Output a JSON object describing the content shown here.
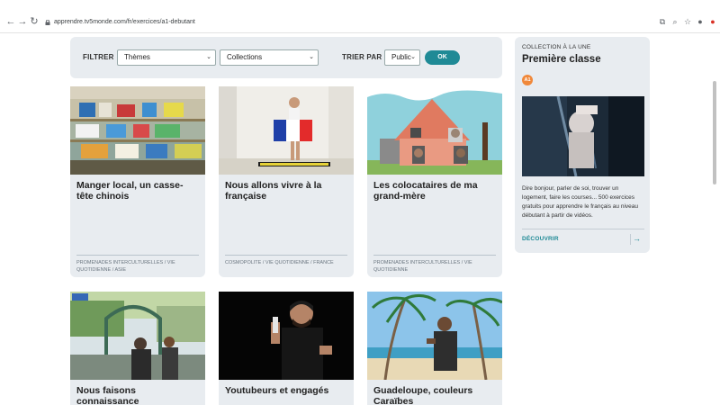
{
  "browser": {
    "url": "apprendre.tv5monde.com/fr/exercices/a1-debutant",
    "icons": [
      "back-icon",
      "forward-icon",
      "reload-icon",
      "lock-icon",
      "translate-icon",
      "zoom-icon",
      "star-icon",
      "account-icon",
      "extension-icon"
    ]
  },
  "filters": {
    "filter_label": "FILTRER",
    "themes_value": "Thèmes",
    "collections_value": "Collections",
    "sort_label": "TRIER PAR",
    "sort_value": "Public",
    "ok_label": "OK"
  },
  "cards": [
    {
      "title": "Manger local, un casse-tête chinois",
      "tags": "PROMENADES INTERCULTURELLES  /  VIE QUOTIDIENNE  /  ASIE"
    },
    {
      "title": "Nous allons vivre à la française",
      "tags": "COSMOPOLITE  /  VIE QUOTIDIENNE  /  FRANCE"
    },
    {
      "title": "Les colocataires de ma grand-mère",
      "tags": "PROMENADES INTERCULTURELLES  /  VIE QUOTIDIENNE"
    },
    {
      "title": "Nous faisons connaissance",
      "tags": ""
    },
    {
      "title": "Youtubeurs et engagés",
      "tags": ""
    },
    {
      "title": "Guadeloupe, couleurs Caraïbes",
      "tags": ""
    }
  ],
  "side": {
    "kicker": "COLLECTION À LA UNE",
    "title": "Première classe",
    "level": "A1",
    "description": "Dire bonjour, parler de soi, trouver un logement, faire les courses... 500 exercices gratuits pour apprendre le français au niveau débutant à partir de vidéos.",
    "link": "DÉCOUVRIR",
    "arrow": "→"
  },
  "colors": {
    "accent": "#1f8a96",
    "card_bg": "#e8ecf0",
    "level_badge": "#f0883a"
  }
}
